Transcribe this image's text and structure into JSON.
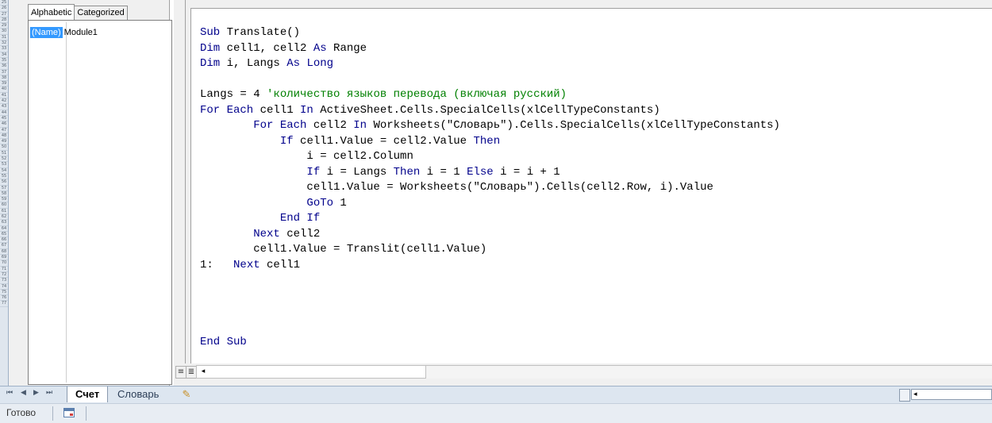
{
  "row_numbers": [
    "25",
    "26",
    "27",
    "28",
    "29",
    "30",
    "31",
    "32",
    "33",
    "34",
    "35",
    "36",
    "37",
    "38",
    "39",
    "40",
    "41",
    "42",
    "43",
    "44",
    "45",
    "46",
    "47",
    "48",
    "49",
    "50",
    "51",
    "52",
    "53",
    "54",
    "55",
    "56",
    "57",
    "58",
    "59",
    "60",
    "61",
    "62",
    "63",
    "64",
    "65",
    "66",
    "67",
    "68",
    "69",
    "70",
    "71",
    "72",
    "73",
    "74",
    "75",
    "76",
    "77"
  ],
  "properties": {
    "tabs": [
      {
        "label": "Alphabetic",
        "active": true
      },
      {
        "label": "Categorized",
        "active": false
      }
    ],
    "row": {
      "name": "(Name)",
      "value": "Module1"
    }
  },
  "code": {
    "lines": [
      [
        {
          "t": "Sub Translate()",
          "c": "kw-mixed"
        }
      ],
      [
        {
          "t": "Dim",
          "c": "kw"
        },
        {
          "t": " cell1, cell2 "
        },
        {
          "t": "As",
          "c": "kw"
        },
        {
          "t": " Range"
        }
      ],
      [
        {
          "t": "Dim",
          "c": "kw"
        },
        {
          "t": " i, Langs "
        },
        {
          "t": "As",
          "c": "kw"
        },
        {
          "t": " "
        },
        {
          "t": "Long",
          "c": "kw"
        }
      ],
      [
        {
          "t": ""
        }
      ],
      [
        {
          "t": "Langs = 4 "
        },
        {
          "t": "'количество языков перевода (включая русский)",
          "c": "cm"
        }
      ],
      [
        {
          "t": "For Each",
          "c": "kw"
        },
        {
          "t": " cell1 "
        },
        {
          "t": "In",
          "c": "kw"
        },
        {
          "t": " ActiveSheet.Cells.SpecialCells(xlCellTypeConstants)"
        }
      ],
      [
        {
          "t": "        "
        },
        {
          "t": "For Each",
          "c": "kw"
        },
        {
          "t": " cell2 "
        },
        {
          "t": "In",
          "c": "kw"
        },
        {
          "t": " Worksheets(\"Словарь\").Cells.SpecialCells(xlCellTypeConstants)"
        }
      ],
      [
        {
          "t": "            "
        },
        {
          "t": "If",
          "c": "kw"
        },
        {
          "t": " cell1.Value = cell2.Value "
        },
        {
          "t": "Then",
          "c": "kw"
        }
      ],
      [
        {
          "t": "                i = cell2.Column"
        }
      ],
      [
        {
          "t": "                "
        },
        {
          "t": "If",
          "c": "kw"
        },
        {
          "t": " i = Langs "
        },
        {
          "t": "Then",
          "c": "kw"
        },
        {
          "t": " i = 1 "
        },
        {
          "t": "Else",
          "c": "kw"
        },
        {
          "t": " i = i + 1"
        }
      ],
      [
        {
          "t": "                cell1.Value = Worksheets(\"Словарь\").Cells(cell2.Row, i).Value"
        }
      ],
      [
        {
          "t": "                "
        },
        {
          "t": "GoTo",
          "c": "kw"
        },
        {
          "t": " 1"
        }
      ],
      [
        {
          "t": "            "
        },
        {
          "t": "End If",
          "c": "kw"
        }
      ],
      [
        {
          "t": "        "
        },
        {
          "t": "Next",
          "c": "kw"
        },
        {
          "t": " cell2"
        }
      ],
      [
        {
          "t": "        cell1.Value = Translit(cell1.Value)"
        }
      ],
      [
        {
          "t": "1:   "
        },
        {
          "t": "Next",
          "c": "kw"
        },
        {
          "t": " cell1"
        }
      ],
      [
        {
          "t": ""
        }
      ],
      [
        {
          "t": ""
        }
      ],
      [
        {
          "t": ""
        }
      ],
      [
        {
          "t": ""
        }
      ],
      [
        {
          "t": "End Sub",
          "c": "kw"
        }
      ]
    ]
  },
  "sheet_tabs": [
    {
      "label": "Счет",
      "active": true
    },
    {
      "label": "Словарь",
      "active": false
    }
  ],
  "status": {
    "text": "Готово"
  },
  "icons": {
    "procedure_view": "≡",
    "module_view": "≣",
    "scroll_left": "◂",
    "nav_first": "⏮",
    "nav_prev": "◀",
    "nav_next": "▶",
    "nav_last": "⏭",
    "new_sheet": "✎"
  },
  "colors": {
    "keyword": "#00008b",
    "comment": "#008000",
    "selection": "#3399ff"
  }
}
